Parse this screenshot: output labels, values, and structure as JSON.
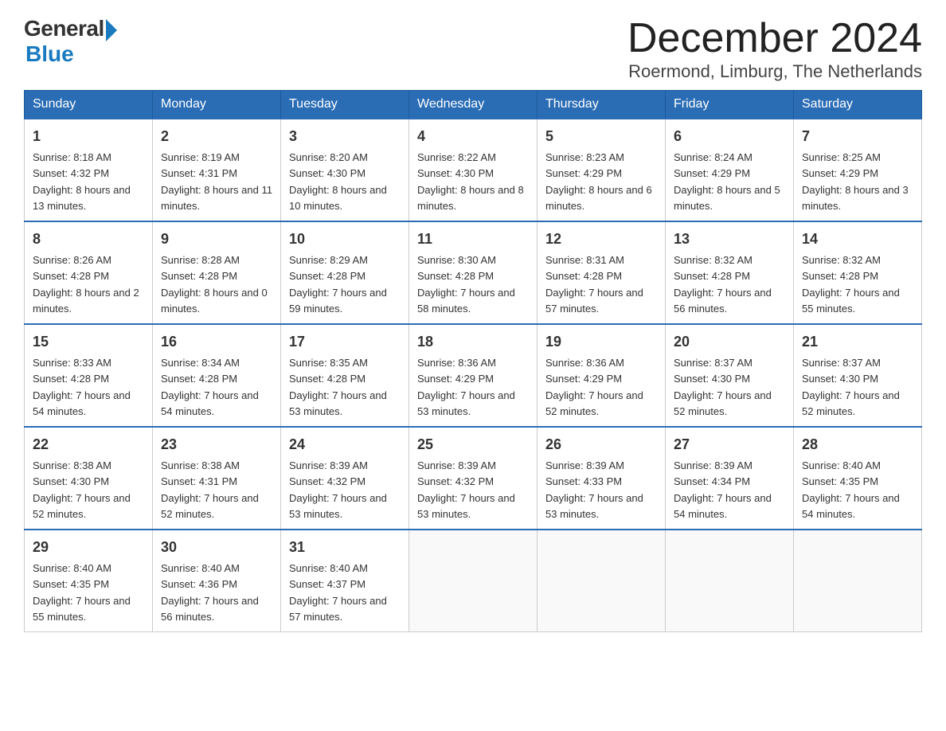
{
  "logo": {
    "text_general": "General",
    "text_blue": "Blue"
  },
  "header": {
    "month_title": "December 2024",
    "location": "Roermond, Limburg, The Netherlands"
  },
  "days_of_week": [
    "Sunday",
    "Monday",
    "Tuesday",
    "Wednesday",
    "Thursday",
    "Friday",
    "Saturday"
  ],
  "weeks": [
    [
      {
        "day": "1",
        "sunrise": "Sunrise: 8:18 AM",
        "sunset": "Sunset: 4:32 PM",
        "daylight": "Daylight: 8 hours and 13 minutes."
      },
      {
        "day": "2",
        "sunrise": "Sunrise: 8:19 AM",
        "sunset": "Sunset: 4:31 PM",
        "daylight": "Daylight: 8 hours and 11 minutes."
      },
      {
        "day": "3",
        "sunrise": "Sunrise: 8:20 AM",
        "sunset": "Sunset: 4:30 PM",
        "daylight": "Daylight: 8 hours and 10 minutes."
      },
      {
        "day": "4",
        "sunrise": "Sunrise: 8:22 AM",
        "sunset": "Sunset: 4:30 PM",
        "daylight": "Daylight: 8 hours and 8 minutes."
      },
      {
        "day": "5",
        "sunrise": "Sunrise: 8:23 AM",
        "sunset": "Sunset: 4:29 PM",
        "daylight": "Daylight: 8 hours and 6 minutes."
      },
      {
        "day": "6",
        "sunrise": "Sunrise: 8:24 AM",
        "sunset": "Sunset: 4:29 PM",
        "daylight": "Daylight: 8 hours and 5 minutes."
      },
      {
        "day": "7",
        "sunrise": "Sunrise: 8:25 AM",
        "sunset": "Sunset: 4:29 PM",
        "daylight": "Daylight: 8 hours and 3 minutes."
      }
    ],
    [
      {
        "day": "8",
        "sunrise": "Sunrise: 8:26 AM",
        "sunset": "Sunset: 4:28 PM",
        "daylight": "Daylight: 8 hours and 2 minutes."
      },
      {
        "day": "9",
        "sunrise": "Sunrise: 8:28 AM",
        "sunset": "Sunset: 4:28 PM",
        "daylight": "Daylight: 8 hours and 0 minutes."
      },
      {
        "day": "10",
        "sunrise": "Sunrise: 8:29 AM",
        "sunset": "Sunset: 4:28 PM",
        "daylight": "Daylight: 7 hours and 59 minutes."
      },
      {
        "day": "11",
        "sunrise": "Sunrise: 8:30 AM",
        "sunset": "Sunset: 4:28 PM",
        "daylight": "Daylight: 7 hours and 58 minutes."
      },
      {
        "day": "12",
        "sunrise": "Sunrise: 8:31 AM",
        "sunset": "Sunset: 4:28 PM",
        "daylight": "Daylight: 7 hours and 57 minutes."
      },
      {
        "day": "13",
        "sunrise": "Sunrise: 8:32 AM",
        "sunset": "Sunset: 4:28 PM",
        "daylight": "Daylight: 7 hours and 56 minutes."
      },
      {
        "day": "14",
        "sunrise": "Sunrise: 8:32 AM",
        "sunset": "Sunset: 4:28 PM",
        "daylight": "Daylight: 7 hours and 55 minutes."
      }
    ],
    [
      {
        "day": "15",
        "sunrise": "Sunrise: 8:33 AM",
        "sunset": "Sunset: 4:28 PM",
        "daylight": "Daylight: 7 hours and 54 minutes."
      },
      {
        "day": "16",
        "sunrise": "Sunrise: 8:34 AM",
        "sunset": "Sunset: 4:28 PM",
        "daylight": "Daylight: 7 hours and 54 minutes."
      },
      {
        "day": "17",
        "sunrise": "Sunrise: 8:35 AM",
        "sunset": "Sunset: 4:28 PM",
        "daylight": "Daylight: 7 hours and 53 minutes."
      },
      {
        "day": "18",
        "sunrise": "Sunrise: 8:36 AM",
        "sunset": "Sunset: 4:29 PM",
        "daylight": "Daylight: 7 hours and 53 minutes."
      },
      {
        "day": "19",
        "sunrise": "Sunrise: 8:36 AM",
        "sunset": "Sunset: 4:29 PM",
        "daylight": "Daylight: 7 hours and 52 minutes."
      },
      {
        "day": "20",
        "sunrise": "Sunrise: 8:37 AM",
        "sunset": "Sunset: 4:30 PM",
        "daylight": "Daylight: 7 hours and 52 minutes."
      },
      {
        "day": "21",
        "sunrise": "Sunrise: 8:37 AM",
        "sunset": "Sunset: 4:30 PM",
        "daylight": "Daylight: 7 hours and 52 minutes."
      }
    ],
    [
      {
        "day": "22",
        "sunrise": "Sunrise: 8:38 AM",
        "sunset": "Sunset: 4:30 PM",
        "daylight": "Daylight: 7 hours and 52 minutes."
      },
      {
        "day": "23",
        "sunrise": "Sunrise: 8:38 AM",
        "sunset": "Sunset: 4:31 PM",
        "daylight": "Daylight: 7 hours and 52 minutes."
      },
      {
        "day": "24",
        "sunrise": "Sunrise: 8:39 AM",
        "sunset": "Sunset: 4:32 PM",
        "daylight": "Daylight: 7 hours and 53 minutes."
      },
      {
        "day": "25",
        "sunrise": "Sunrise: 8:39 AM",
        "sunset": "Sunset: 4:32 PM",
        "daylight": "Daylight: 7 hours and 53 minutes."
      },
      {
        "day": "26",
        "sunrise": "Sunrise: 8:39 AM",
        "sunset": "Sunset: 4:33 PM",
        "daylight": "Daylight: 7 hours and 53 minutes."
      },
      {
        "day": "27",
        "sunrise": "Sunrise: 8:39 AM",
        "sunset": "Sunset: 4:34 PM",
        "daylight": "Daylight: 7 hours and 54 minutes."
      },
      {
        "day": "28",
        "sunrise": "Sunrise: 8:40 AM",
        "sunset": "Sunset: 4:35 PM",
        "daylight": "Daylight: 7 hours and 54 minutes."
      }
    ],
    [
      {
        "day": "29",
        "sunrise": "Sunrise: 8:40 AM",
        "sunset": "Sunset: 4:35 PM",
        "daylight": "Daylight: 7 hours and 55 minutes."
      },
      {
        "day": "30",
        "sunrise": "Sunrise: 8:40 AM",
        "sunset": "Sunset: 4:36 PM",
        "daylight": "Daylight: 7 hours and 56 minutes."
      },
      {
        "day": "31",
        "sunrise": "Sunrise: 8:40 AM",
        "sunset": "Sunset: 4:37 PM",
        "daylight": "Daylight: 7 hours and 57 minutes."
      },
      null,
      null,
      null,
      null
    ]
  ]
}
